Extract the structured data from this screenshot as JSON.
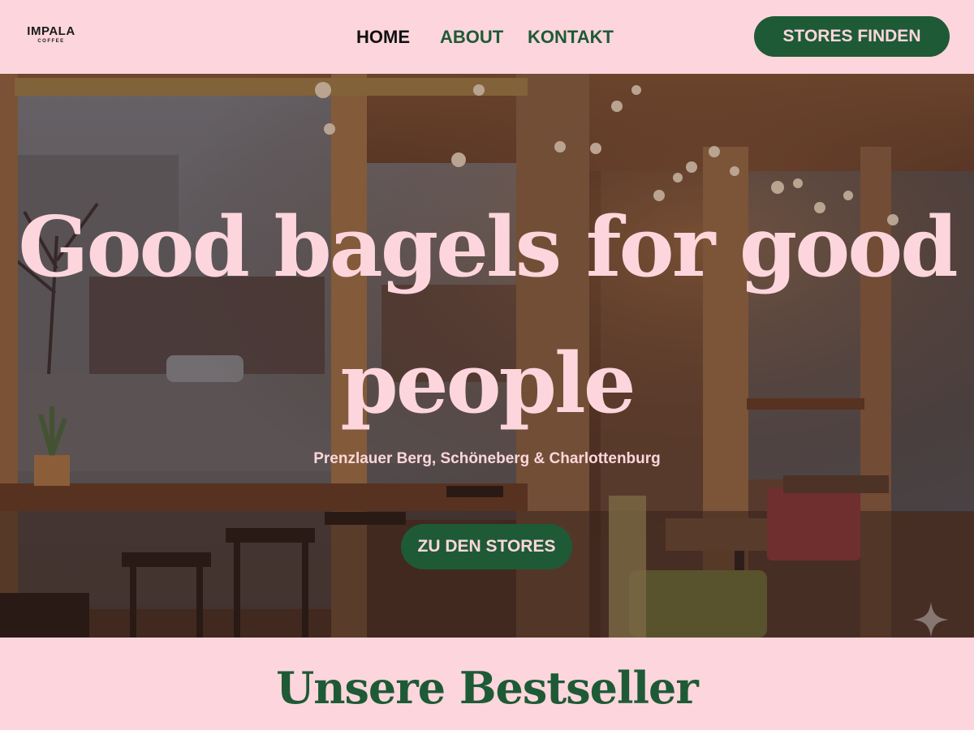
{
  "brand": {
    "logo_text": "IMPALA",
    "logo_subtext": "COFFEE"
  },
  "nav": {
    "items": [
      {
        "label": "HOME",
        "active": true
      },
      {
        "label": "ABOUT",
        "active": false
      },
      {
        "label": "KONTAKT",
        "active": false
      }
    ],
    "cta_label": "STORES FINDEN"
  },
  "hero": {
    "title": "Good bagels for good people",
    "subtitle": "Prenzlauer Berg, Schöneberg & Charlottenburg",
    "cta_label": "ZU DEN STORES",
    "background": "cafe-interior-photo",
    "corner_icon": "sparkle-icon"
  },
  "bestseller": {
    "title": "Unsere Bestseller"
  },
  "colors": {
    "background_pink": "#fcd6dc",
    "accent_green": "#1e5a36",
    "text_dark": "#111111"
  }
}
